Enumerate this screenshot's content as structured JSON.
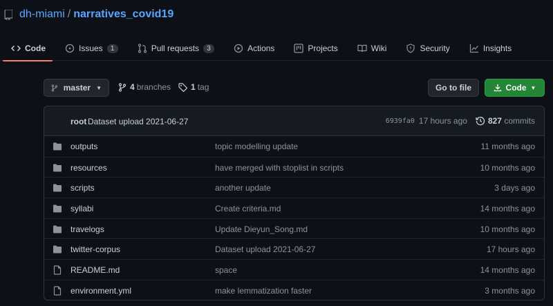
{
  "repo": {
    "owner": "dh-miami",
    "separator": "/",
    "name": "narratives_covid19"
  },
  "tabs": [
    {
      "label": "Code",
      "icon": "code-icon",
      "active": true
    },
    {
      "label": "Issues",
      "icon": "issue-icon",
      "count": "1"
    },
    {
      "label": "Pull requests",
      "icon": "pull-request-icon",
      "count": "3"
    },
    {
      "label": "Actions",
      "icon": "play-icon"
    },
    {
      "label": "Projects",
      "icon": "project-icon"
    },
    {
      "label": "Wiki",
      "icon": "book-icon"
    },
    {
      "label": "Security",
      "icon": "shield-icon"
    },
    {
      "label": "Insights",
      "icon": "graph-icon"
    }
  ],
  "toolbar": {
    "branch": "master",
    "branches_count": "4",
    "branches_label": "branches",
    "tags_count": "1",
    "tags_label": "tag",
    "goto_label": "Go to file",
    "code_label": "Code"
  },
  "commit": {
    "author": "root",
    "message": "Dataset upload 2021-06-27",
    "sha": "6939fa0",
    "ago": "17 hours ago",
    "commits_count": "827",
    "commits_label": "commits"
  },
  "files": [
    {
      "name": "outputs",
      "type": "folder",
      "message": "topic modelling update",
      "age": "11 months ago"
    },
    {
      "name": "resources",
      "type": "folder",
      "message": "have merged with stoplist in scripts",
      "age": "10 months ago"
    },
    {
      "name": "scripts",
      "type": "folder",
      "message": "another update",
      "age": "3 days ago"
    },
    {
      "name": "syllabi",
      "type": "folder",
      "message": "Create criteria.md",
      "age": "14 months ago"
    },
    {
      "name": "travelogs",
      "type": "folder",
      "message": "Update Dieyun_Song.md",
      "age": "10 months ago"
    },
    {
      "name": "twitter-corpus",
      "type": "folder",
      "message": "Dataset upload 2021-06-27",
      "age": "17 hours ago"
    },
    {
      "name": "README.md",
      "type": "file",
      "message": "space",
      "age": "14 months ago"
    },
    {
      "name": "environment.yml",
      "type": "file",
      "message": "make lemmatization faster",
      "age": "3 months ago"
    }
  ],
  "colors": {
    "background": "#0d1117",
    "link": "#58a6ff",
    "accent_tab": "#f78166",
    "code_button": "#238636",
    "folder": "#8b949e"
  }
}
